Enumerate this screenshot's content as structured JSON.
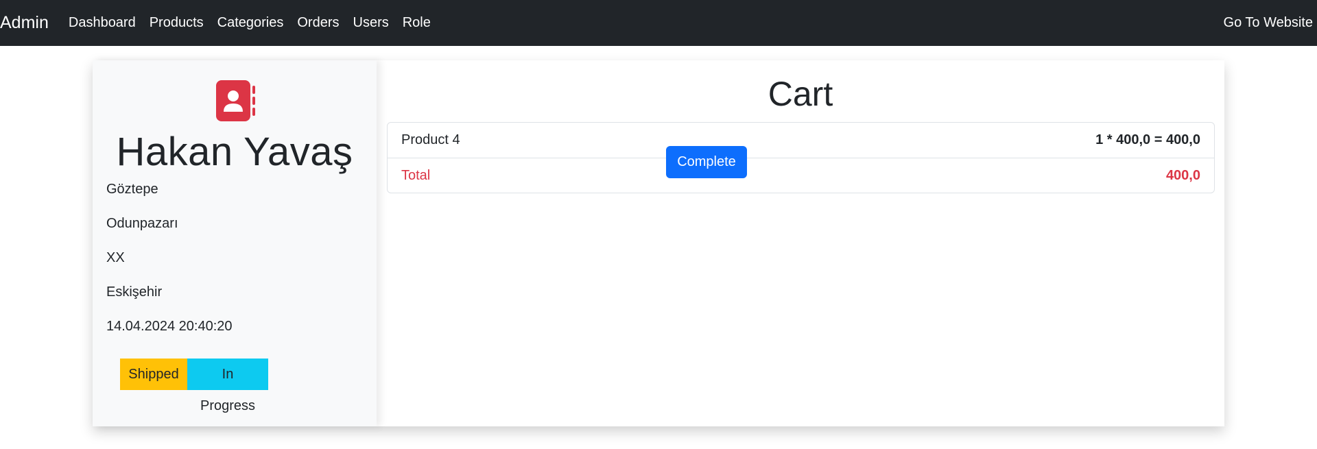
{
  "navbar": {
    "brand": "Admin",
    "links": [
      "Dashboard",
      "Products",
      "Categories",
      "Orders",
      "Users",
      "Role"
    ],
    "right_link": "Go To Website"
  },
  "profile": {
    "icon": "contact-book-icon",
    "icon_color": "#dc3545",
    "name": "Hakan Yavaş",
    "lines": [
      "Göztepe",
      "Odunpazarı",
      "XX",
      "Eskişehir",
      "14.04.2024 20:40:20"
    ],
    "badges": {
      "shipped": "Shipped",
      "in_progress": "In Progress"
    }
  },
  "cart": {
    "title": "Cart",
    "items": [
      {
        "name": "Product 4",
        "calc": "1 * 400,0 = 400,0"
      }
    ],
    "total_label": "Total",
    "total_value": "400,0",
    "complete_label": "Complete"
  },
  "colors": {
    "navbar": "#212529",
    "primary": "#0d6efd",
    "danger": "#dc3545",
    "warning": "#ffc107",
    "info": "#0dcaf0"
  }
}
